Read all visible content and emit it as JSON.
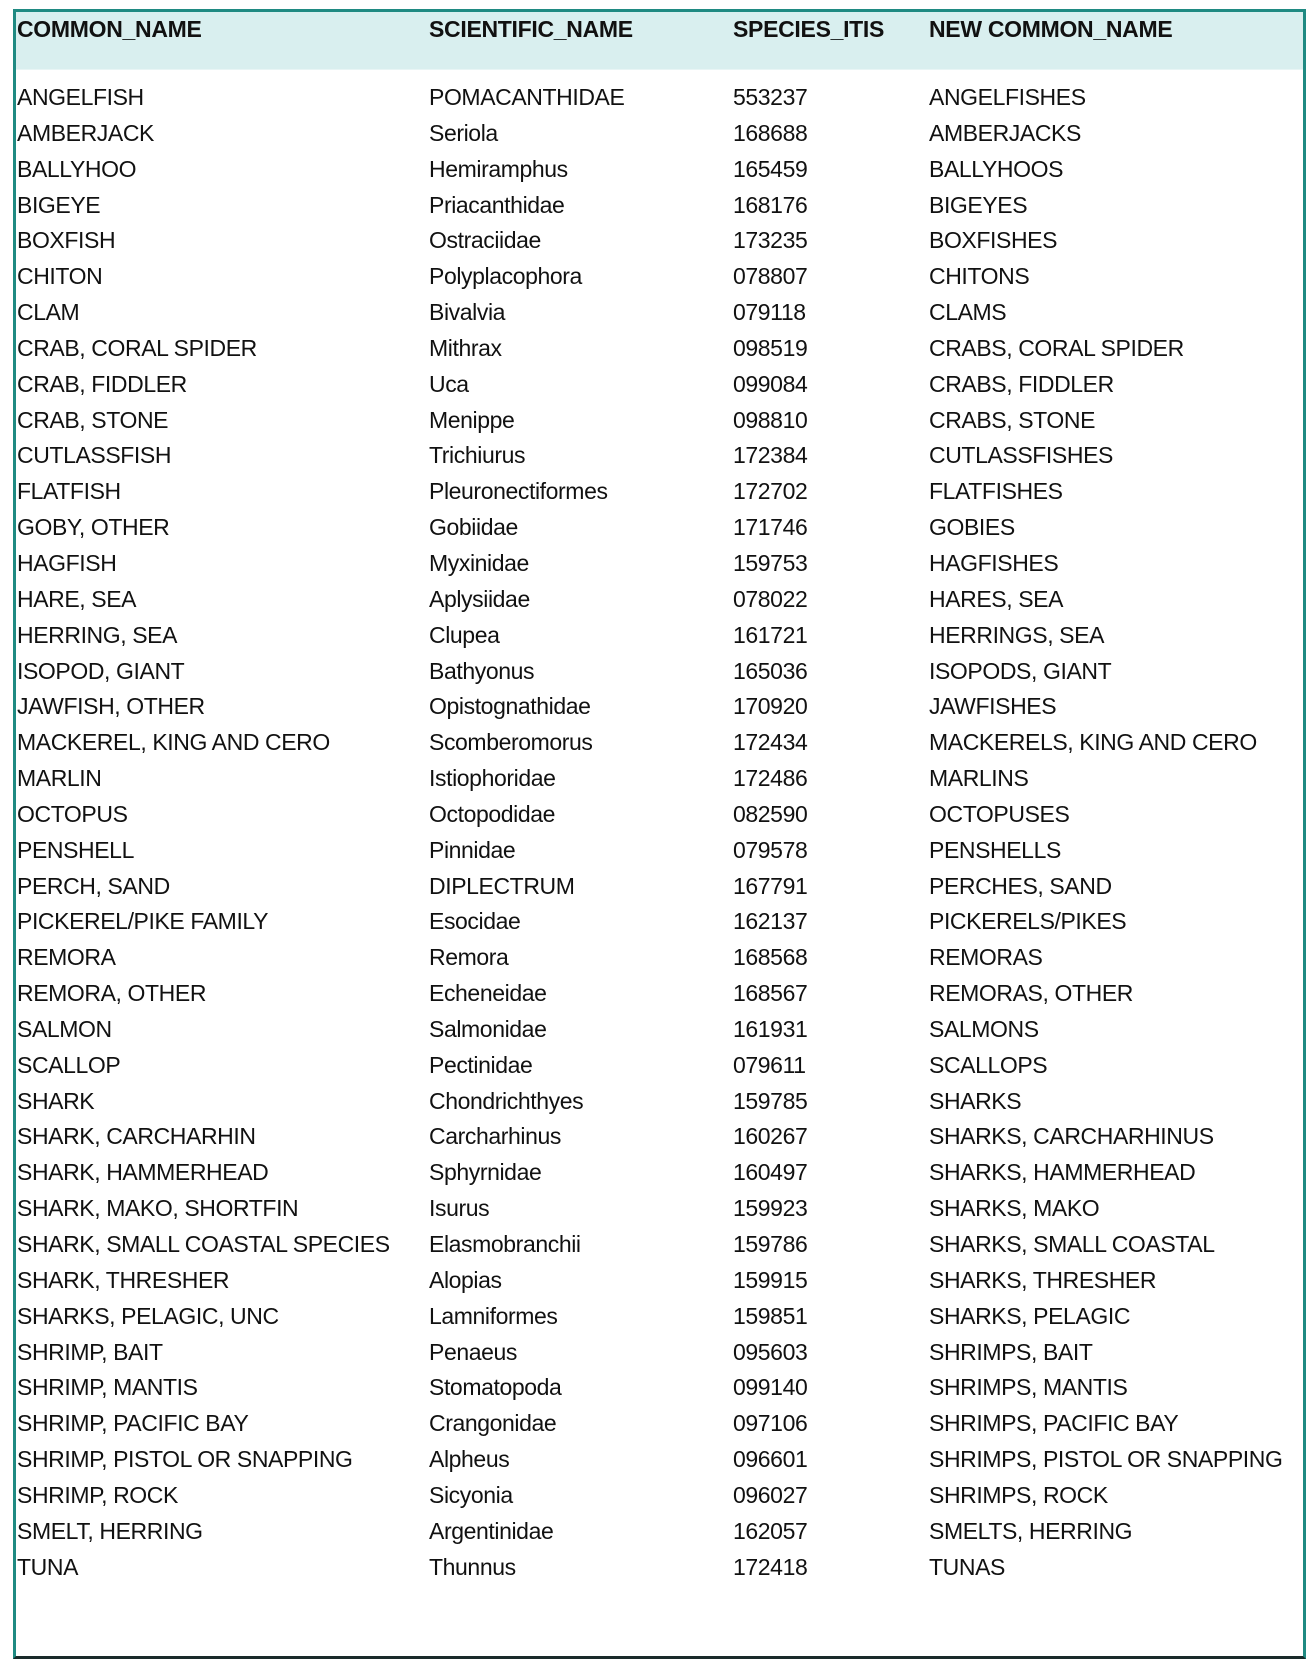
{
  "table": {
    "columns": [
      "COMMON_NAME",
      "SCIENTIFIC_NAME",
      "SPECIES_ITIS",
      "NEW COMMON_NAME"
    ],
    "rows": [
      [
        "ANGELFISH",
        "POMACANTHIDAE",
        "553237",
        "ANGELFISHES"
      ],
      [
        "AMBERJACK",
        "Seriola",
        "168688",
        "AMBERJACKS"
      ],
      [
        "BALLYHOO",
        "Hemiramphus",
        "165459",
        "BALLYHOOS"
      ],
      [
        "BIGEYE",
        "Priacanthidae",
        "168176",
        "BIGEYES"
      ],
      [
        "BOXFISH",
        "Ostraciidae",
        "173235",
        "BOXFISHES"
      ],
      [
        "CHITON",
        "Polyplacophora",
        "078807",
        "CHITONS"
      ],
      [
        "CLAM",
        "Bivalvia",
        "079118",
        "CLAMS"
      ],
      [
        "CRAB, CORAL SPIDER",
        "Mithrax",
        "098519",
        "CRABS, CORAL SPIDER"
      ],
      [
        "CRAB, FIDDLER",
        "Uca",
        "099084",
        "CRABS, FIDDLER"
      ],
      [
        "CRAB, STONE",
        "Menippe",
        "098810",
        "CRABS, STONE"
      ],
      [
        "CUTLASSFISH",
        "Trichiurus",
        "172384",
        "CUTLASSFISHES"
      ],
      [
        "FLATFISH",
        "Pleuronectiformes",
        "172702",
        "FLATFISHES"
      ],
      [
        "GOBY, OTHER",
        "Gobiidae",
        "171746",
        "GOBIES"
      ],
      [
        "HAGFISH",
        "Myxinidae",
        "159753",
        "HAGFISHES"
      ],
      [
        "HARE, SEA",
        "Aplysiidae",
        "078022",
        "HARES, SEA"
      ],
      [
        "HERRING, SEA",
        "Clupea",
        "161721",
        "HERRINGS, SEA"
      ],
      [
        "ISOPOD, GIANT",
        "Bathyonus",
        "165036",
        "ISOPODS, GIANT"
      ],
      [
        "JAWFISH, OTHER",
        "Opistognathidae",
        "170920",
        "JAWFISHES"
      ],
      [
        "MACKEREL, KING AND CERO",
        "Scomberomorus",
        "172434",
        "MACKERELS, KING AND CERO"
      ],
      [
        "MARLIN",
        "Istiophoridae",
        "172486",
        "MARLINS"
      ],
      [
        "OCTOPUS",
        "Octopodidae",
        "082590",
        "OCTOPUSES"
      ],
      [
        "PENSHELL",
        "Pinnidae",
        "079578",
        "PENSHELLS"
      ],
      [
        "PERCH, SAND",
        "DIPLECTRUM",
        "167791",
        "PERCHES, SAND"
      ],
      [
        "PICKEREL/PIKE FAMILY",
        "Esocidae",
        "162137",
        "PICKERELS/PIKES"
      ],
      [
        "REMORA",
        "Remora",
        "168568",
        "REMORAS"
      ],
      [
        "REMORA, OTHER",
        "Echeneidae",
        "168567",
        "REMORAS, OTHER"
      ],
      [
        "SALMON",
        "Salmonidae",
        "161931",
        "SALMONS"
      ],
      [
        "SCALLOP",
        "Pectinidae",
        "079611",
        "SCALLOPS"
      ],
      [
        "SHARK",
        "Chondrichthyes",
        "159785",
        "SHARKS"
      ],
      [
        "SHARK, CARCHARHIN",
        "Carcharhinus",
        "160267",
        "SHARKS, CARCHARHINUS"
      ],
      [
        "SHARK, HAMMERHEAD",
        "Sphyrnidae",
        "160497",
        "SHARKS, HAMMERHEAD"
      ],
      [
        "SHARK, MAKO, SHORTFIN",
        "Isurus",
        "159923",
        "SHARKS, MAKO"
      ],
      [
        "SHARK, SMALL COASTAL SPECIES",
        "Elasmobranchii",
        "159786",
        "SHARKS, SMALL COASTAL"
      ],
      [
        "SHARK, THRESHER",
        "Alopias",
        "159915",
        "SHARKS, THRESHER"
      ],
      [
        "SHARKS, PELAGIC, UNC",
        "Lamniformes",
        "159851",
        "SHARKS, PELAGIC"
      ],
      [
        "SHRIMP, BAIT",
        "Penaeus",
        "095603",
        "SHRIMPS, BAIT"
      ],
      [
        "SHRIMP, MANTIS",
        "Stomatopoda",
        "099140",
        "SHRIMPS, MANTIS"
      ],
      [
        "SHRIMP, PACIFIC BAY",
        "Crangonidae",
        "097106",
        "SHRIMPS, PACIFIC BAY"
      ],
      [
        "SHRIMP, PISTOL OR SNAPPING",
        "Alpheus",
        "096601",
        "SHRIMPS, PISTOL OR SNAPPING"
      ],
      [
        "SHRIMP, ROCK",
        "Sicyonia",
        "096027",
        "SHRIMPS, ROCK"
      ],
      [
        "SMELT, HERRING",
        "Argentinidae",
        "162057",
        "SMELTS, HERRING"
      ],
      [
        "TUNA",
        "Thunnus",
        "172418",
        "TUNAS"
      ]
    ]
  },
  "colors": {
    "header_background": "#d9efef",
    "border_accent": "#1f8a82"
  }
}
